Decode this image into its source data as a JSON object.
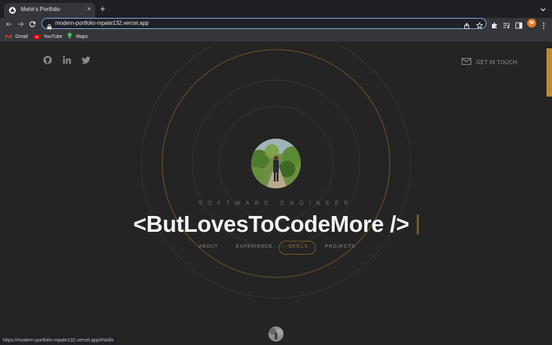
{
  "browser": {
    "tab": {
      "title": "Mahir's Portfolio",
      "close_glyph": "×"
    },
    "new_tab_glyph": "+",
    "address": {
      "url": "modern-portfolio-mpate132.vercel.app"
    },
    "profile_initial": "M",
    "bookmarks": [
      {
        "label": "Gmail",
        "icon": "gmail-icon"
      },
      {
        "label": "YouTube",
        "icon": "youtube-icon"
      },
      {
        "label": "Maps",
        "icon": "maps-icon"
      }
    ]
  },
  "page": {
    "social": [
      "github-icon",
      "linkedin-icon",
      "twitter-icon"
    ],
    "contact_label": "GET IN TOUCH",
    "role": "SOFTWARE ENGINEER",
    "headline": "<ButLovesToCodeMore />",
    "nav": [
      {
        "label": "ABOUT",
        "active": false
      },
      {
        "label": "EXPERIENCE",
        "active": false
      },
      {
        "label": "SKILLS",
        "active": true
      },
      {
        "label": "PROJECTS",
        "active": false
      }
    ]
  },
  "status_bar": {
    "hover_url": "https://modern-portfolio-mpate132.vercel.app/#skills"
  },
  "colors": {
    "accent": "#c08a2e",
    "background": "#242424",
    "omnibox_focus": "#8ab4f8"
  }
}
